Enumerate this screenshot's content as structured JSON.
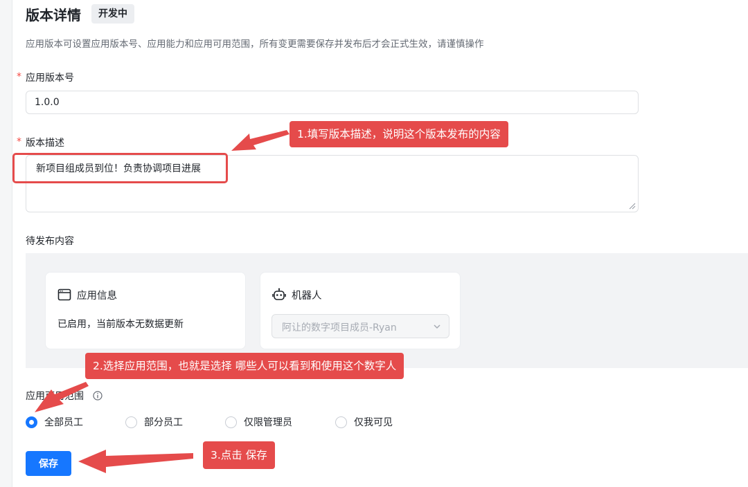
{
  "header": {
    "title": "版本详情",
    "status_badge": "开发中",
    "description": "应用版本可设置应用版本号、应用能力和应用可用范围，所有变更需要保存并发布后才会正式生效，请谨慎操作"
  },
  "version_field": {
    "label": "应用版本号",
    "value": "1.0.0"
  },
  "description_field": {
    "label": "版本描述",
    "value": "新项目组成员到位！负责协调项目进展"
  },
  "pending": {
    "label": "待发布内容",
    "app_info_card": {
      "title": "应用信息",
      "icon": "window-icon",
      "text": "已启用，当前版本无数据更新"
    },
    "bot_card": {
      "title": "机器人",
      "icon": "robot-icon",
      "selected": "阿让的数字项目成员-Ryan"
    }
  },
  "scope": {
    "label": "应用可用范围",
    "options": [
      "全部员工",
      "部分员工",
      "仅限管理员",
      "仅我可见"
    ],
    "selected": "全部员工"
  },
  "actions": {
    "save_label": "保存"
  },
  "annotations": {
    "step1": "1.填写版本描述，说明这个版本发布的内容",
    "step2": "2.选择应用范围，也就是选择 哪些人可以看到和使用这个数字人",
    "step3": "3.点击 保存"
  },
  "colors": {
    "primary": "#1677ff",
    "annotation_red": "#e54b4b",
    "panel_bg": "#f2f3f5"
  }
}
